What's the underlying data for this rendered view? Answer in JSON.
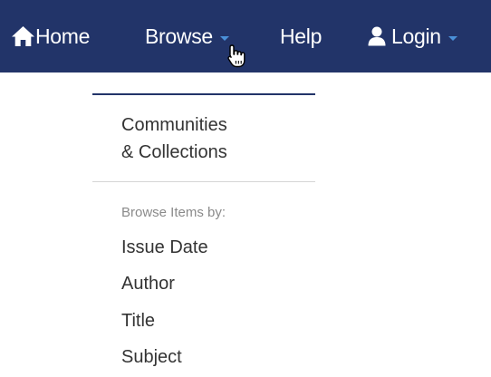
{
  "navbar": {
    "background": "#223469",
    "home": {
      "label": "Home",
      "icon": "home-icon"
    },
    "browse": {
      "label": "Browse",
      "icon": "caret-down-icon"
    },
    "help": {
      "label": "Help"
    },
    "login": {
      "label": "Login",
      "icon": "user-icon"
    }
  },
  "browse_menu": {
    "communities_line1": "Communities",
    "communities_line2": "& Collections",
    "section_header": "Browse Items by:",
    "items": [
      "Issue Date",
      "Author",
      "Title",
      "Subject"
    ]
  }
}
